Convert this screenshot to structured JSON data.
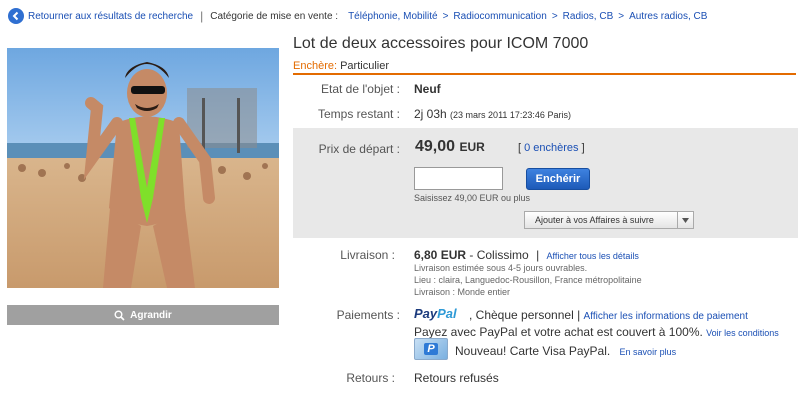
{
  "topbar": {
    "back_label": "Retourner aux résultats de recherche",
    "category_label": "Catégorie de mise en vente :",
    "breadcrumb": [
      "Téléphonie, Mobilité",
      "Radiocommunication",
      "Radios, CB",
      "Autres radios, CB"
    ]
  },
  "image": {
    "enlarge_label": "Agrandir"
  },
  "item": {
    "title": "Lot de deux accessoires pour ICOM 7000",
    "bid_type_label": "Enchère:",
    "bid_type_value": "Particulier",
    "condition_label": "Etat de l'objet :",
    "condition_value": "Neuf",
    "time_label": "Temps restant :",
    "time_value": "2j 03h",
    "time_detail": "(23 mars 2011 17:23:46 Paris)"
  },
  "bidding": {
    "start_price_label": "Prix de départ :",
    "price": "49,00",
    "currency": "EUR",
    "bids_open": "[",
    "bids_link": "0 enchères",
    "bids_close": "]",
    "bid_input_value": "",
    "bid_button": "Enchérir",
    "bid_hint": "Saisissez 49,00 EUR ou plus",
    "watch_button": "Ajouter à vos Affaires à suivre"
  },
  "shipping": {
    "label": "Livraison :",
    "price": "6,80 EUR",
    "method": "- Colissimo",
    "divider": "|",
    "fees_link": "Afficher tous les détails",
    "estimate": "Livraison estimée sous 4-5 jours ouvrables.",
    "location": "Lieu : claira, Languedoc-Rousillon, France métropolitaine",
    "ships_to": "Livraison : Monde entier"
  },
  "payment": {
    "label": "Paiements :",
    "paypal_part1": "Pay",
    "paypal_part2": "Pal",
    "methods": ", Chèque personnel |",
    "info_link": "Afficher les informations de paiement",
    "coverage": "Payez avec PayPal et votre achat est couvert à 100%.",
    "conditions_link": "Voir les conditions",
    "card_text": "Nouveau! Carte Visa PayPal.",
    "more_link": "En savoir plus"
  },
  "returns": {
    "label": "Retours :",
    "value": "Retours refusés"
  },
  "colors": {
    "accent_orange": "#e36b00",
    "link_blue": "#1a4fb4",
    "button_blue": "#1d5ab8"
  }
}
